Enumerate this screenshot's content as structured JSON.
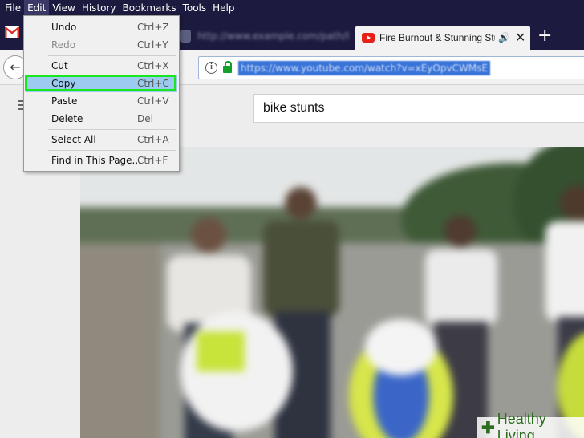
{
  "menubar": [
    "File",
    "Edit",
    "View",
    "History",
    "Bookmarks",
    "Tools",
    "Help"
  ],
  "tabs": {
    "faded_title": "http://www.example.com/path/to/page",
    "active_title": "Fire Burnout & Stunning Stunts",
    "active_speaker": "🔊",
    "active_close": "✕",
    "new_tab": "+"
  },
  "nav": {
    "back": "←",
    "url": "https://www.youtube.com/watch?v=xEyOpvCWMsE"
  },
  "search": {
    "value": "bike stunts"
  },
  "edit_menu": [
    {
      "label": "Undo",
      "shortcut": "Ctrl+Z"
    },
    {
      "label": "Redo",
      "shortcut": "Ctrl+Y"
    },
    {
      "label": "Cut",
      "shortcut": "Ctrl+X"
    },
    {
      "label": "Copy",
      "shortcut": "Ctrl+C"
    },
    {
      "label": "Paste",
      "shortcut": "Ctrl+V"
    },
    {
      "label": "Delete",
      "shortcut": "Del"
    },
    {
      "label": "Select All",
      "shortcut": "Ctrl+A"
    },
    {
      "label": "Find in This Page...",
      "shortcut": "Ctrl+F"
    }
  ],
  "watermark": {
    "brand": "Healthy Living"
  },
  "colors": {
    "menubar": "#1c1b3f",
    "highlight_box": "#17e81d",
    "menu_highlight": "#9ccaf0",
    "url_selection": "#3874d8"
  }
}
